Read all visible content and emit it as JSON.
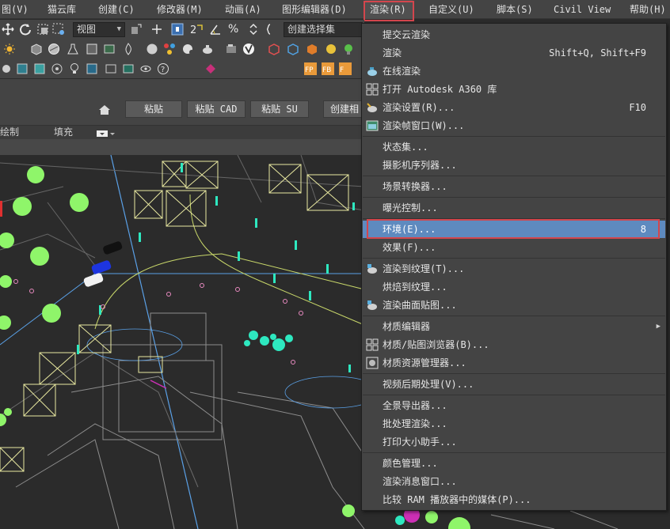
{
  "menubar": {
    "items": [
      {
        "label": "图(V)"
      },
      {
        "label": "猫云库"
      },
      {
        "label": "创建(C)"
      },
      {
        "label": "修改器(M)"
      },
      {
        "label": "动画(A)"
      },
      {
        "label": "图形编辑器(D)"
      },
      {
        "label": "渲染(R)"
      },
      {
        "label": "自定义(U)"
      },
      {
        "label": "脚本(S)"
      },
      {
        "label": "Civil View"
      },
      {
        "label": "帮助(H)"
      }
    ]
  },
  "toolbar": {
    "view_combo": "视图",
    "selection_set_combo": "创建选择集",
    "percent_icon_text": "%"
  },
  "ribbon": {
    "paste_label": "粘贴",
    "paste_cad_label": "粘贴 CAD",
    "paste_su_label": "粘贴 SU",
    "create_label": "创建相"
  },
  "subbar": {
    "draw_label": "绘制",
    "fill_label": "填充"
  },
  "render_menu": {
    "items": [
      {
        "label": "提交云渲染",
        "shortcut": ""
      },
      {
        "label": "渲染",
        "shortcut": "Shift+Q, Shift+F9"
      },
      {
        "label": "在线渲染",
        "shortcut": ""
      },
      {
        "label": "打开 Autodesk A360 库",
        "shortcut": ""
      },
      {
        "label": "渲染设置(R)...",
        "shortcut": "F10"
      },
      {
        "label": "渲染帧窗口(W)...",
        "shortcut": ""
      },
      {
        "label": "状态集...",
        "shortcut": ""
      },
      {
        "label": "摄影机序列器...",
        "shortcut": ""
      },
      {
        "label": "场景转换器...",
        "shortcut": ""
      },
      {
        "label": "曝光控制...",
        "shortcut": ""
      },
      {
        "label": "环境(E)...",
        "shortcut": "8"
      },
      {
        "label": "效果(F)...",
        "shortcut": ""
      },
      {
        "label": "渲染到纹理(T)...",
        "shortcut": ""
      },
      {
        "label": "烘焙到纹理...",
        "shortcut": ""
      },
      {
        "label": "渲染曲面贴图...",
        "shortcut": ""
      },
      {
        "label": "材质编辑器",
        "shortcut": ""
      },
      {
        "label": "材质/贴图浏览器(B)...",
        "shortcut": ""
      },
      {
        "label": "材质资源管理器...",
        "shortcut": ""
      },
      {
        "label": "视频后期处理(V)...",
        "shortcut": ""
      },
      {
        "label": "全景导出器...",
        "shortcut": ""
      },
      {
        "label": "批处理渲染...",
        "shortcut": ""
      },
      {
        "label": "打印大小助手...",
        "shortcut": ""
      },
      {
        "label": "颜色管理...",
        "shortcut": ""
      },
      {
        "label": "渲染消息窗口...",
        "shortcut": ""
      },
      {
        "label": "比较 RAM 播放器中的媒体(P)...",
        "shortcut": ""
      }
    ],
    "submenu_arrow": "▶"
  },
  "colors": {
    "menu_bg": "#444444",
    "highlight": "#5e8abf",
    "callout_red": "#d3464d",
    "viewport_bg": "#2b2b2b",
    "tree_green": "#8ff56a",
    "teal": "#2ee8c0",
    "wire_yellow": "#e8e89a"
  }
}
